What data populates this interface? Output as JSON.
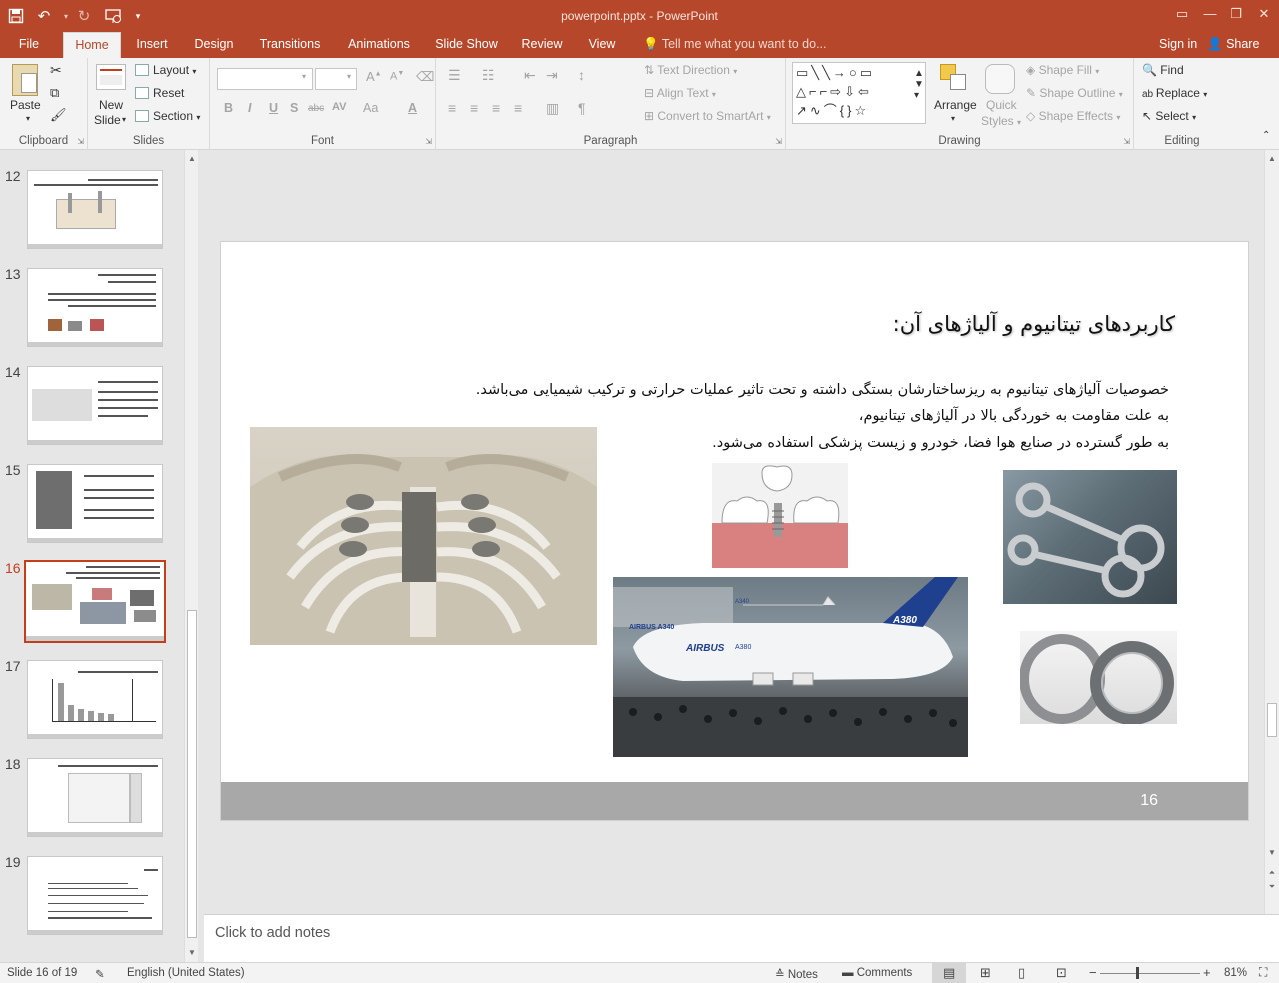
{
  "titlebar": {
    "title": "powerpoint.pptx - PowerPoint",
    "qat_icons": [
      "save-icon",
      "undo-icon",
      "redo-icon",
      "present-from-beginning-icon",
      "customize-qat-icon"
    ],
    "win_icons": [
      "ribbon-display-options-icon",
      "minimize-icon",
      "restore-icon",
      "close-icon"
    ],
    "win_glyphs": [
      "▭",
      "—",
      "❐",
      "✕"
    ]
  },
  "tabs": [
    {
      "label": "File"
    },
    {
      "label": "Home",
      "active": true
    },
    {
      "label": "Insert"
    },
    {
      "label": "Design"
    },
    {
      "label": "Transitions"
    },
    {
      "label": "Animations"
    },
    {
      "label": "Slide Show"
    },
    {
      "label": "Review"
    },
    {
      "label": "View"
    }
  ],
  "tell_me": "Tell me what you want to do...",
  "sign_in": "Sign in",
  "share": "Share",
  "ribbon": {
    "clipboard": {
      "label": "Clipboard",
      "paste": "Paste"
    },
    "slides": {
      "label": "Slides",
      "new_slide_line1": "New",
      "new_slide_line2": "Slide",
      "layout": "Layout",
      "reset": "Reset",
      "section": "Section"
    },
    "font": {
      "label": "Font",
      "bold": "B",
      "italic": "I",
      "underline": "U",
      "shadow": "S",
      "strike": "abc",
      "spacing": "AV",
      "case": "Aa",
      "color": "A"
    },
    "paragraph": {
      "label": "Paragraph",
      "text_direction": "Text Direction",
      "align_text": "Align Text",
      "convert_smartart": "Convert to SmartArt"
    },
    "drawing": {
      "label": "Drawing",
      "arrange": "Arrange",
      "quick_styles_line1": "Quick",
      "quick_styles_line2": "Styles",
      "shape_fill": "Shape Fill",
      "shape_outline": "Shape Outline",
      "shape_effects": "Shape Effects"
    },
    "editing": {
      "label": "Editing",
      "find": "Find",
      "replace": "Replace",
      "select": "Select"
    }
  },
  "thumbnails": [
    {
      "number": "12"
    },
    {
      "number": "13"
    },
    {
      "number": "14"
    },
    {
      "number": "15"
    },
    {
      "number": "16",
      "active": true
    },
    {
      "number": "17"
    },
    {
      "number": "18"
    },
    {
      "number": "19"
    }
  ],
  "slide": {
    "title": "کاربردهای تیتانیوم و آلیاژهای آن:",
    "body": [
      "خصوصیات آلیاژهای تیتانیوم به ریزساختارشان بستگی داشته و تحت تاثیر عملیات حرارتی و ترکیب شیمیایی می‌باشد.",
      "به علت مقاومت به خوردگی بالا در آلیاژهای تیتانیوم،",
      "به طور گسترده در صنایع هوا فضا، خودرو و زیست پزشکی استفاده می‌شود."
    ],
    "footer_number": "16",
    "images": {
      "airplane_labels": [
        "AIRBUS A340",
        "AIRBUS",
        "A380",
        "A380",
        "A340"
      ]
    }
  },
  "notes_placeholder": "Click to add notes",
  "statusbar": {
    "slide_info": "Slide 16 of 19",
    "language": "English (United States)",
    "notes": "Notes",
    "comments": "Comments",
    "zoom": "81%",
    "zoom_out": "−",
    "zoom_in": "+"
  },
  "colors": {
    "accent": "#b7472a",
    "active_thumb": "#c43e1c"
  }
}
